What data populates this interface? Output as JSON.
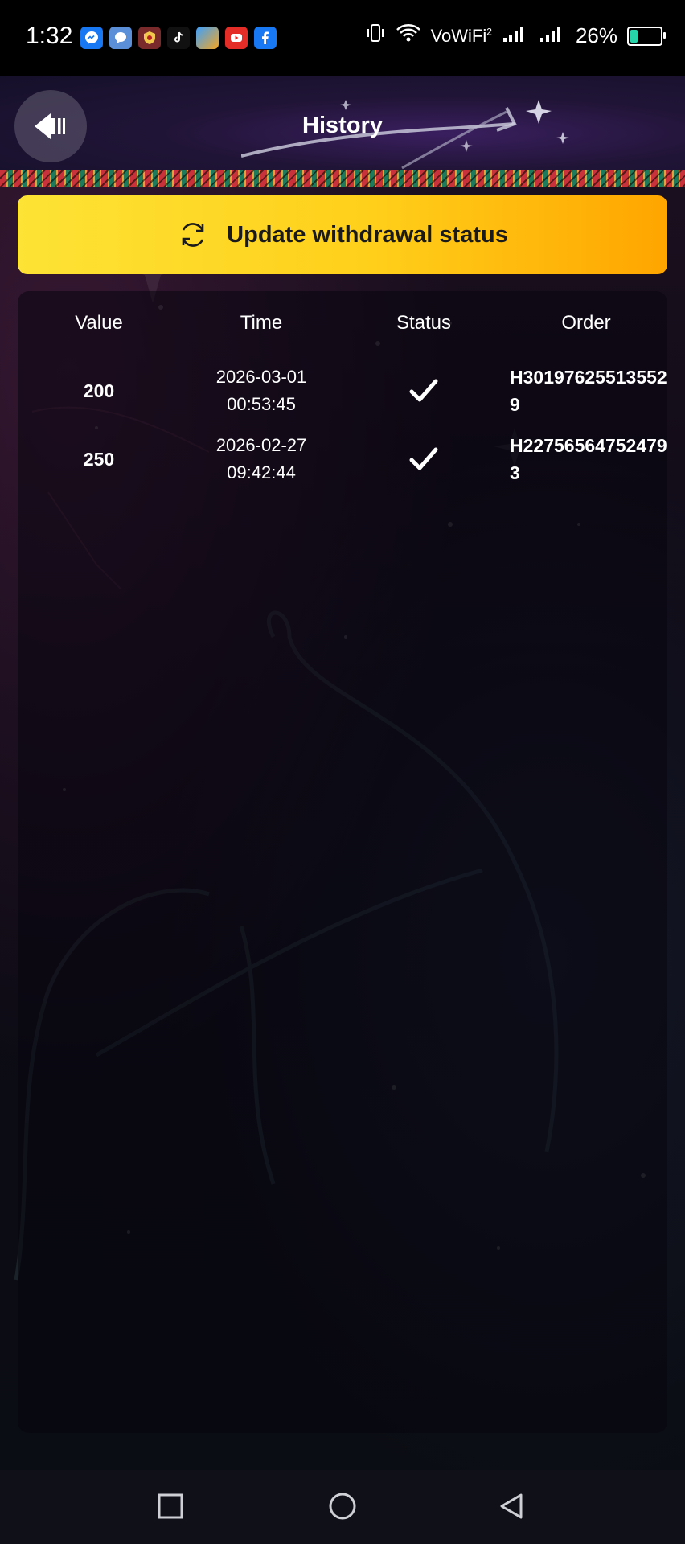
{
  "status_bar": {
    "time": "1:32",
    "signal_label": "VoWiFi",
    "signal_sup": "2",
    "battery_percent": "26%",
    "battery_level": 0.26,
    "app_icons": [
      "messenger-icon",
      "chat-icon",
      "shield-app-icon",
      "tiktok-icon",
      "game-app-icon",
      "youtube-icon",
      "facebook-icon"
    ]
  },
  "header": {
    "title": "History",
    "back_icon": "back-arrow-icon"
  },
  "update_button": {
    "label": "Update withdrawal status",
    "icon": "refresh-icon",
    "colors": [
      "#fde335",
      "#ffa500"
    ]
  },
  "table": {
    "columns": [
      "Value",
      "Time",
      "Status",
      "Order"
    ],
    "rows": [
      {
        "value": "200",
        "date": "2026-03-01",
        "clock": "00:53:45",
        "status": "check-icon",
        "order": "H301976255135529"
      },
      {
        "value": "250",
        "date": "2026-02-27",
        "clock": "09:42:44",
        "status": "check-icon",
        "order": "H227565647524793"
      }
    ]
  },
  "nav_bar": {
    "icons": [
      "recent-apps-icon",
      "home-icon",
      "back-icon"
    ]
  }
}
